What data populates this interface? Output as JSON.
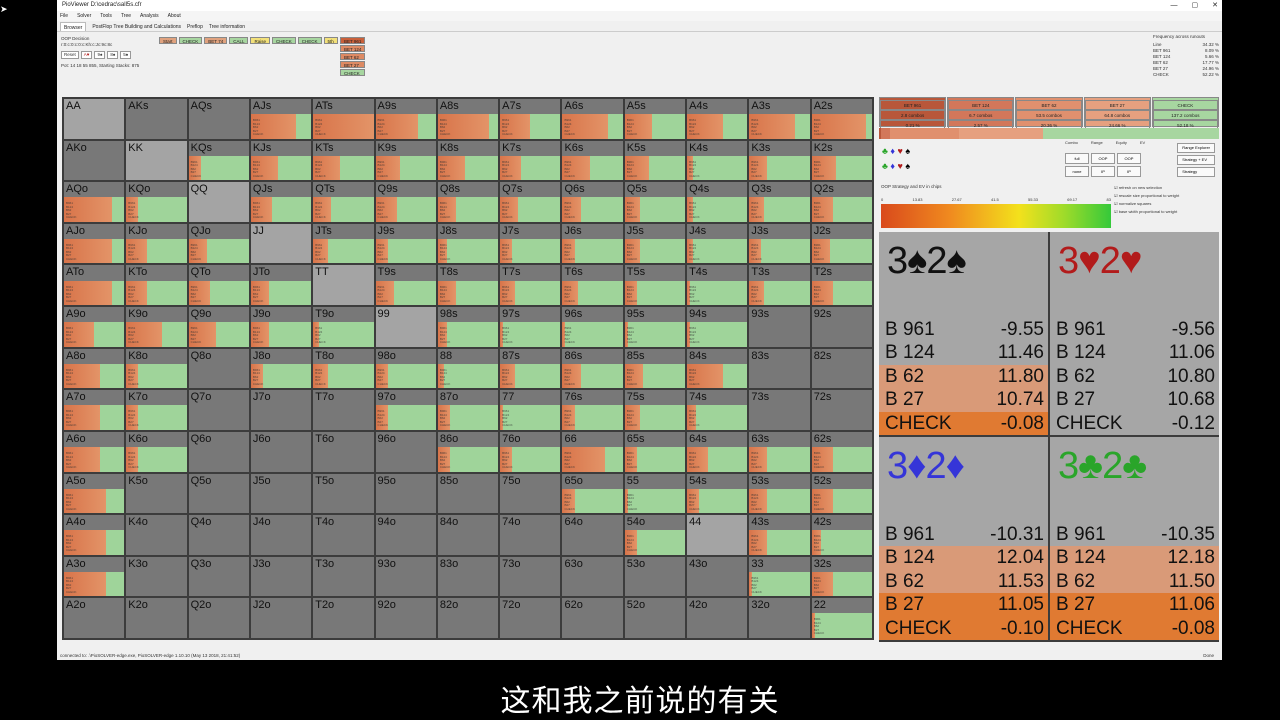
{
  "window": {
    "title": "PioViewer D:\\cedrac\\sall5s.cfr",
    "controls": [
      "—",
      "▢",
      "✕"
    ]
  },
  "menu": [
    "File",
    "Solver",
    "Tools",
    "Tree",
    "Analysis",
    "About"
  ],
  "tabs": [
    "Browser",
    "PostFlop Tree Building and Calculations",
    "Preflop",
    "Tree information"
  ],
  "decision": {
    "title": "OOP Decision",
    "line": "r:0:c:0:c:0:c:Kh:c:Jc:9c:8c",
    "reset_label": "Reset",
    "board_cards": [
      "A♥",
      "9♠",
      "8♠",
      "5♠"
    ],
    "footer": "Pot: 14 18 55 855, Starting Stacks: 875"
  },
  "actions": {
    "row": [
      "Start",
      "CHECK",
      "BET 74",
      "CALL",
      "Raise",
      "CHECK",
      "CHECK",
      "5th"
    ],
    "row_colors": [
      "#e0a27e",
      "#a7d6a0",
      "#e0a27e",
      "#a7d6a0",
      "#f3e17a",
      "#a7d6a0",
      "#a7d6a0",
      "#f3e17a"
    ],
    "column": [
      "BET 961",
      "BET 124",
      "BET 62",
      "BET 27",
      "CHECK"
    ],
    "column_colors": [
      "#c9603a",
      "#dd8a63",
      "#dd8a63",
      "#dd8a63",
      "#a7d6a0"
    ]
  },
  "frequency": {
    "title": "Frequency across runouts",
    "rows": [
      {
        "label": "Line",
        "value": "34.32 %"
      },
      {
        "label": "BET 961",
        "value": "8.09 %"
      },
      {
        "label": "BET 124",
        "value": "5.66 %"
      },
      {
        "label": "BET 62",
        "value": "17.77 %"
      },
      {
        "label": "BET 27",
        "value": "24.96 %"
      },
      {
        "label": "CHECK",
        "value": "52.22 %"
      }
    ]
  },
  "summary": [
    {
      "label": "BET 961",
      "combos": "2.8 combos",
      "pct": "0.21 %",
      "color": "#b8573a"
    },
    {
      "label": "BET 124",
      "combos": "6.7 combos",
      "pct": "2.57 %",
      "color": "#d2775a"
    },
    {
      "label": "BET 62",
      "combos": "53.5 combos",
      "pct": "20.36 %",
      "color": "#e0906e"
    },
    {
      "label": "BET 27",
      "combos": "64.8 combos",
      "pct": "24.66 %",
      "color": "#e6a07f"
    },
    {
      "label": "CHECK",
      "combos": "137.2 combos",
      "pct": "52.18 %",
      "color": "#a7d6a0"
    }
  ],
  "summary_strip": [
    {
      "share": 0.6,
      "color": "#b8573a"
    },
    {
      "share": 2.6,
      "color": "#d2775a"
    },
    {
      "share": 20.4,
      "color": "#e0906e"
    },
    {
      "share": 24.7,
      "color": "#e6a07f"
    },
    {
      "share": 51.7,
      "color": "#a7d6a0"
    }
  ],
  "controls": {
    "suits_row1": [
      "♣",
      "♦",
      "♥",
      "♠"
    ],
    "suits_row2": [
      "♣",
      "♦",
      "♥",
      "♠"
    ],
    "heads": [
      "Combo",
      "Range",
      "Equity",
      "EV"
    ],
    "buttons": [
      "full",
      "OOP",
      "OOP",
      "OOP",
      "none",
      "IP",
      "IP",
      "IP"
    ],
    "right": [
      "Range Explorer",
      "Strategy + EV",
      "Strategy"
    ],
    "checks": [
      "refresh on new selection",
      "rescale size proportional to weight",
      "normalize squares",
      "base width proportional to weight"
    ],
    "gradient_label": "OOP Strategy and EV in chips",
    "gradient_ticks": [
      "0",
      "13.83",
      "27.67",
      "41.5",
      "55.33",
      "69.17",
      "83"
    ]
  },
  "hand_grid": {
    "ranks": [
      "A",
      "K",
      "Q",
      "J",
      "T",
      "9",
      "8",
      "7",
      "6",
      "5",
      "4",
      "3",
      "2"
    ],
    "colors": {
      "bet": "#e39468",
      "bet_dark": "#d8744a",
      "check": "#9fd49a",
      "empty": "#787878",
      "blocked": "#a4a4a4"
    },
    "mini_lines": [
      "B961",
      "B124",
      "B62",
      "B27",
      "CHECK"
    ],
    "cells": [
      [
        {
          "h": "AA",
          "s": "blocked"
        },
        {
          "h": "AKs",
          "s": "empty"
        },
        {
          "h": "AQs",
          "s": "empty"
        },
        {
          "h": "AJs",
          "s": "mix",
          "b": 0.75
        },
        {
          "h": "ATs",
          "s": "mix",
          "b": 1.0
        },
        {
          "h": "A9s",
          "s": "mix",
          "b": 0.7
        },
        {
          "h": "A8s",
          "s": "mix",
          "b": 0.85
        },
        {
          "h": "A7s",
          "s": "mix",
          "b": 0.5
        },
        {
          "h": "A6s",
          "s": "mix",
          "b": 0.75
        },
        {
          "h": "A5s",
          "s": "mix",
          "b": 0.45
        },
        {
          "h": "A4s",
          "s": "mix",
          "b": 0.6
        },
        {
          "h": "A3s",
          "s": "mix",
          "b": 0.75
        },
        {
          "h": "A2s",
          "s": "mix",
          "b": 0.9
        }
      ],
      [
        {
          "h": "AKo",
          "s": "empty"
        },
        {
          "h": "KK",
          "s": "blocked"
        },
        {
          "h": "KQs",
          "s": "mix",
          "b": 0.2
        },
        {
          "h": "KJs",
          "s": "mix",
          "b": 0.45
        },
        {
          "h": "KTs",
          "s": "mix",
          "b": 0.45
        },
        {
          "h": "K9s",
          "s": "mix",
          "b": 0.4
        },
        {
          "h": "K8s",
          "s": "mix",
          "b": 0.45
        },
        {
          "h": "K7s",
          "s": "mix",
          "b": 0.35
        },
        {
          "h": "K6s",
          "s": "mix",
          "b": 0.45
        },
        {
          "h": "K5s",
          "s": "mix",
          "b": 0.4
        },
        {
          "h": "K4s",
          "s": "mix",
          "b": 0.1
        },
        {
          "h": "K3s",
          "s": "mix",
          "b": 0.3
        },
        {
          "h": "K2s",
          "s": "mix",
          "b": 0.4
        }
      ],
      [
        {
          "h": "AQo",
          "s": "mix",
          "b": 0.8
        },
        {
          "h": "KQo",
          "s": "mix",
          "b": 0.2
        },
        {
          "h": "QQ",
          "s": "blocked"
        },
        {
          "h": "QJs",
          "s": "mix",
          "b": 0.35
        },
        {
          "h": "QTs",
          "s": "mix",
          "b": 0.3
        },
        {
          "h": "Q9s",
          "s": "mix",
          "b": 0.35
        },
        {
          "h": "Q8s",
          "s": "mix",
          "b": 0.3
        },
        {
          "h": "Q7s",
          "s": "mix",
          "b": 0.3
        },
        {
          "h": "Q6s",
          "s": "mix",
          "b": 0.3
        },
        {
          "h": "Q5s",
          "s": "mix",
          "b": 0.25
        },
        {
          "h": "Q4s",
          "s": "mix",
          "b": 0.1
        },
        {
          "h": "Q3s",
          "s": "mix",
          "b": 0.25
        },
        {
          "h": "Q2s",
          "s": "mix",
          "b": 0.35
        }
      ],
      [
        {
          "h": "AJo",
          "s": "mix",
          "b": 0.8
        },
        {
          "h": "KJo",
          "s": "mix",
          "b": 0.35
        },
        {
          "h": "QJo",
          "s": "mix",
          "b": 0.3
        },
        {
          "h": "JJ",
          "s": "blocked"
        },
        {
          "h": "JTs",
          "s": "mix",
          "b": 0.25
        },
        {
          "h": "J9s",
          "s": "mix",
          "b": 0.2
        },
        {
          "h": "J8s",
          "s": "mix",
          "b": 0.15
        },
        {
          "h": "J7s",
          "s": "mix",
          "b": 0.2
        },
        {
          "h": "J6s",
          "s": "mix",
          "b": 0.2
        },
        {
          "h": "J5s",
          "s": "mix",
          "b": 0.25
        },
        {
          "h": "J4s",
          "s": "mix",
          "b": 0.1
        },
        {
          "h": "J3s",
          "s": "mix",
          "b": 0.2
        },
        {
          "h": "J2s",
          "s": "mix",
          "b": 0.3
        }
      ],
      [
        {
          "h": "ATo",
          "s": "mix",
          "b": 0.8
        },
        {
          "h": "KTo",
          "s": "mix",
          "b": 0.35
        },
        {
          "h": "QTo",
          "s": "mix",
          "b": 0.35
        },
        {
          "h": "JTo",
          "s": "mix",
          "b": 0.3
        },
        {
          "h": "TT",
          "s": "blocked"
        },
        {
          "h": "T9s",
          "s": "mix",
          "b": 0.3
        },
        {
          "h": "T8s",
          "s": "mix",
          "b": 0.3
        },
        {
          "h": "T7s",
          "s": "mix",
          "b": 0.25
        },
        {
          "h": "T6s",
          "s": "mix",
          "b": 0.25
        },
        {
          "h": "T5s",
          "s": "mix",
          "b": 0.2
        },
        {
          "h": "T4s",
          "s": "mix",
          "b": 0.05
        },
        {
          "h": "T3s",
          "s": "mix",
          "b": 0.25
        },
        {
          "h": "T2s",
          "s": "mix",
          "b": 0.35
        }
      ],
      [
        {
          "h": "A9o",
          "s": "mix",
          "b": 0.5
        },
        {
          "h": "K9o",
          "s": "mix",
          "b": 0.6
        },
        {
          "h": "Q9o",
          "s": "mix",
          "b": 0.45
        },
        {
          "h": "J9o",
          "s": "mix",
          "b": 0.3
        },
        {
          "h": "T9o",
          "s": "mix",
          "b": 0.1
        },
        {
          "h": "99",
          "s": "blocked"
        },
        {
          "h": "98s",
          "s": "mix",
          "b": 0.15
        },
        {
          "h": "97s",
          "s": "mix",
          "b": 0.05
        },
        {
          "h": "96s",
          "s": "mix",
          "b": 0.05
        },
        {
          "h": "95s",
          "s": "mix",
          "b": 0.05
        },
        {
          "h": "94s",
          "s": "mix",
          "b": 0.05
        },
        {
          "h": "93s",
          "s": "empty"
        },
        {
          "h": "92s",
          "s": "empty"
        }
      ],
      [
        {
          "h": "A8o",
          "s": "mix",
          "b": 0.6
        },
        {
          "h": "K8o",
          "s": "mix",
          "b": 0.2
        },
        {
          "h": "Q8o",
          "s": "empty"
        },
        {
          "h": "J8o",
          "s": "mix",
          "b": 0.2
        },
        {
          "h": "T8o",
          "s": "mix",
          "b": 0.25
        },
        {
          "h": "98o",
          "s": "mix",
          "b": 0.2
        },
        {
          "h": "88",
          "s": "mix",
          "b": 0.1
        },
        {
          "h": "87s",
          "s": "mix",
          "b": 0.25
        },
        {
          "h": "86s",
          "s": "mix",
          "b": 0.3
        },
        {
          "h": "85s",
          "s": "mix",
          "b": 0.3
        },
        {
          "h": "84s",
          "s": "mix",
          "b": 0.6
        },
        {
          "h": "83s",
          "s": "empty"
        },
        {
          "h": "82s",
          "s": "empty"
        }
      ],
      [
        {
          "h": "A7o",
          "s": "mix",
          "b": 0.6
        },
        {
          "h": "K7o",
          "s": "mix",
          "b": 0.2
        },
        {
          "h": "Q7o",
          "s": "empty"
        },
        {
          "h": "J7o",
          "s": "empty"
        },
        {
          "h": "T7o",
          "s": "empty"
        },
        {
          "h": "97o",
          "s": "mix",
          "b": 0.2
        },
        {
          "h": "87o",
          "s": "mix",
          "b": 0.2
        },
        {
          "h": "77",
          "s": "mix",
          "b": 0.05
        },
        {
          "h": "76s",
          "s": "mix",
          "b": 0.2
        },
        {
          "h": "75s",
          "s": "mix",
          "b": 0.25
        },
        {
          "h": "74s",
          "s": "mix",
          "b": 0.15
        },
        {
          "h": "73s",
          "s": "empty"
        },
        {
          "h": "72s",
          "s": "empty"
        }
      ],
      [
        {
          "h": "A6o",
          "s": "mix",
          "b": 0.6
        },
        {
          "h": "K6o",
          "s": "mix",
          "b": 0.2
        },
        {
          "h": "Q6o",
          "s": "empty"
        },
        {
          "h": "J6o",
          "s": "empty"
        },
        {
          "h": "T6o",
          "s": "empty"
        },
        {
          "h": "96o",
          "s": "empty"
        },
        {
          "h": "86o",
          "s": "mix",
          "b": 0.2
        },
        {
          "h": "76o",
          "s": "mix",
          "b": 0.2
        },
        {
          "h": "66",
          "s": "mix",
          "b": 0.7
        },
        {
          "h": "65s",
          "s": "mix",
          "b": 0.2
        },
        {
          "h": "64s",
          "s": "mix",
          "b": 0.35
        },
        {
          "h": "63s",
          "s": "mix",
          "b": 0.3
        },
        {
          "h": "62s",
          "s": "mix",
          "b": 0.35
        }
      ],
      [
        {
          "h": "A5o",
          "s": "mix",
          "b": 0.7
        },
        {
          "h": "K5o",
          "s": "empty"
        },
        {
          "h": "Q5o",
          "s": "empty"
        },
        {
          "h": "J5o",
          "s": "empty"
        },
        {
          "h": "T5o",
          "s": "empty"
        },
        {
          "h": "95o",
          "s": "empty"
        },
        {
          "h": "85o",
          "s": "empty"
        },
        {
          "h": "75o",
          "s": "empty"
        },
        {
          "h": "65o",
          "s": "mix",
          "b": 0.2
        },
        {
          "h": "55",
          "s": "mix",
          "b": 0.05
        },
        {
          "h": "54s",
          "s": "mix",
          "b": 0.2
        },
        {
          "h": "53s",
          "s": "mix",
          "b": 0.3
        },
        {
          "h": "52s",
          "s": "mix",
          "b": 0.35
        }
      ],
      [
        {
          "h": "A4o",
          "s": "mix",
          "b": 0.7
        },
        {
          "h": "K4o",
          "s": "empty"
        },
        {
          "h": "Q4o",
          "s": "empty"
        },
        {
          "h": "J4o",
          "s": "empty"
        },
        {
          "h": "T4o",
          "s": "empty"
        },
        {
          "h": "94o",
          "s": "empty"
        },
        {
          "h": "84o",
          "s": "empty"
        },
        {
          "h": "74o",
          "s": "empty"
        },
        {
          "h": "64o",
          "s": "empty"
        },
        {
          "h": "54o",
          "s": "mix",
          "b": 0.2
        },
        {
          "h": "44",
          "s": "blocked"
        },
        {
          "h": "43s",
          "s": "mix",
          "b": 0.3
        },
        {
          "h": "42s",
          "s": "mix",
          "b": 0.15
        }
      ],
      [
        {
          "h": "A3o",
          "s": "mix",
          "b": 0.7
        },
        {
          "h": "K3o",
          "s": "empty"
        },
        {
          "h": "Q3o",
          "s": "empty"
        },
        {
          "h": "J3o",
          "s": "empty"
        },
        {
          "h": "T3o",
          "s": "empty"
        },
        {
          "h": "93o",
          "s": "empty"
        },
        {
          "h": "83o",
          "s": "empty"
        },
        {
          "h": "73o",
          "s": "empty"
        },
        {
          "h": "63o",
          "s": "empty"
        },
        {
          "h": "53o",
          "s": "empty"
        },
        {
          "h": "43o",
          "s": "empty"
        },
        {
          "h": "33",
          "s": "mix",
          "b": 0.05
        },
        {
          "h": "32s",
          "s": "mix",
          "b": 0.35
        }
      ],
      [
        {
          "h": "A2o",
          "s": "empty"
        },
        {
          "h": "K2o",
          "s": "empty"
        },
        {
          "h": "Q2o",
          "s": "empty"
        },
        {
          "h": "J2o",
          "s": "empty"
        },
        {
          "h": "T2o",
          "s": "empty"
        },
        {
          "h": "92o",
          "s": "empty"
        },
        {
          "h": "82o",
          "s": "empty"
        },
        {
          "h": "72o",
          "s": "empty"
        },
        {
          "h": "62o",
          "s": "empty"
        },
        {
          "h": "52o",
          "s": "empty"
        },
        {
          "h": "42o",
          "s": "empty"
        },
        {
          "h": "32o",
          "s": "empty"
        },
        {
          "h": "22",
          "s": "mix",
          "b": 0.05
        }
      ]
    ]
  },
  "combos": [
    {
      "hand": "3♠2♠",
      "color": "#111111",
      "rows": [
        {
          "label": "B 961",
          "value": "-9.55",
          "bg": "#a6a6a6"
        },
        {
          "label": "B 124",
          "value": "11.46",
          "bg": "#a6a6a6"
        },
        {
          "label": "B 62",
          "value": "11.80",
          "bg": "#d99a78"
        },
        {
          "label": "B 27",
          "value": "10.74",
          "bg": "#d99a78"
        },
        {
          "label": "CHECK",
          "value": "-0.08",
          "bg": "#e07a32"
        }
      ]
    },
    {
      "hand": "3♥2♥",
      "color": "#b21b1b",
      "rows": [
        {
          "label": "B 961",
          "value": "-9.56",
          "bg": "#a6a6a6"
        },
        {
          "label": "B 124",
          "value": "11.06",
          "bg": "#a6a6a6"
        },
        {
          "label": "B 62",
          "value": "10.80",
          "bg": "#a6a6a6"
        },
        {
          "label": "B 27",
          "value": "10.68",
          "bg": "#a6a6a6"
        },
        {
          "label": "CHECK",
          "value": "-0.12",
          "bg": "#a6a6a6"
        }
      ]
    },
    {
      "hand": "3♦2♦",
      "color": "#3535d8",
      "rows": [
        {
          "label": "B 961",
          "value": "-10.31",
          "bg": "#a6a6a6"
        },
        {
          "label": "B 124",
          "value": "12.04",
          "bg": "#d99a78"
        },
        {
          "label": "B 62",
          "value": "11.53",
          "bg": "#d99a78"
        },
        {
          "label": "B 27",
          "value": "11.05",
          "bg": "#e07a32"
        },
        {
          "label": "CHECK",
          "value": "-0.10",
          "bg": "#e07a32"
        }
      ]
    },
    {
      "hand": "3♣2♣",
      "color": "#2aa52a",
      "rows": [
        {
          "label": "B 961",
          "value": "-10.35",
          "bg": "#a6a6a6"
        },
        {
          "label": "B 124",
          "value": "12.18",
          "bg": "#d99a78"
        },
        {
          "label": "B 62",
          "value": "11.50",
          "bg": "#d99a78"
        },
        {
          "label": "B 27",
          "value": "11.06",
          "bg": "#e07a32"
        },
        {
          "label": "CHECK",
          "value": "-0.08",
          "bg": "#e07a32"
        }
      ]
    }
  ],
  "status": {
    "text": "connected to: .\\PioSOLVER-edge.exe, PioSOLVER-edge 1.10.10 (May 13 2018, 21:41:52)",
    "right": "Done"
  },
  "subtitle": "这和我之前说的有关"
}
